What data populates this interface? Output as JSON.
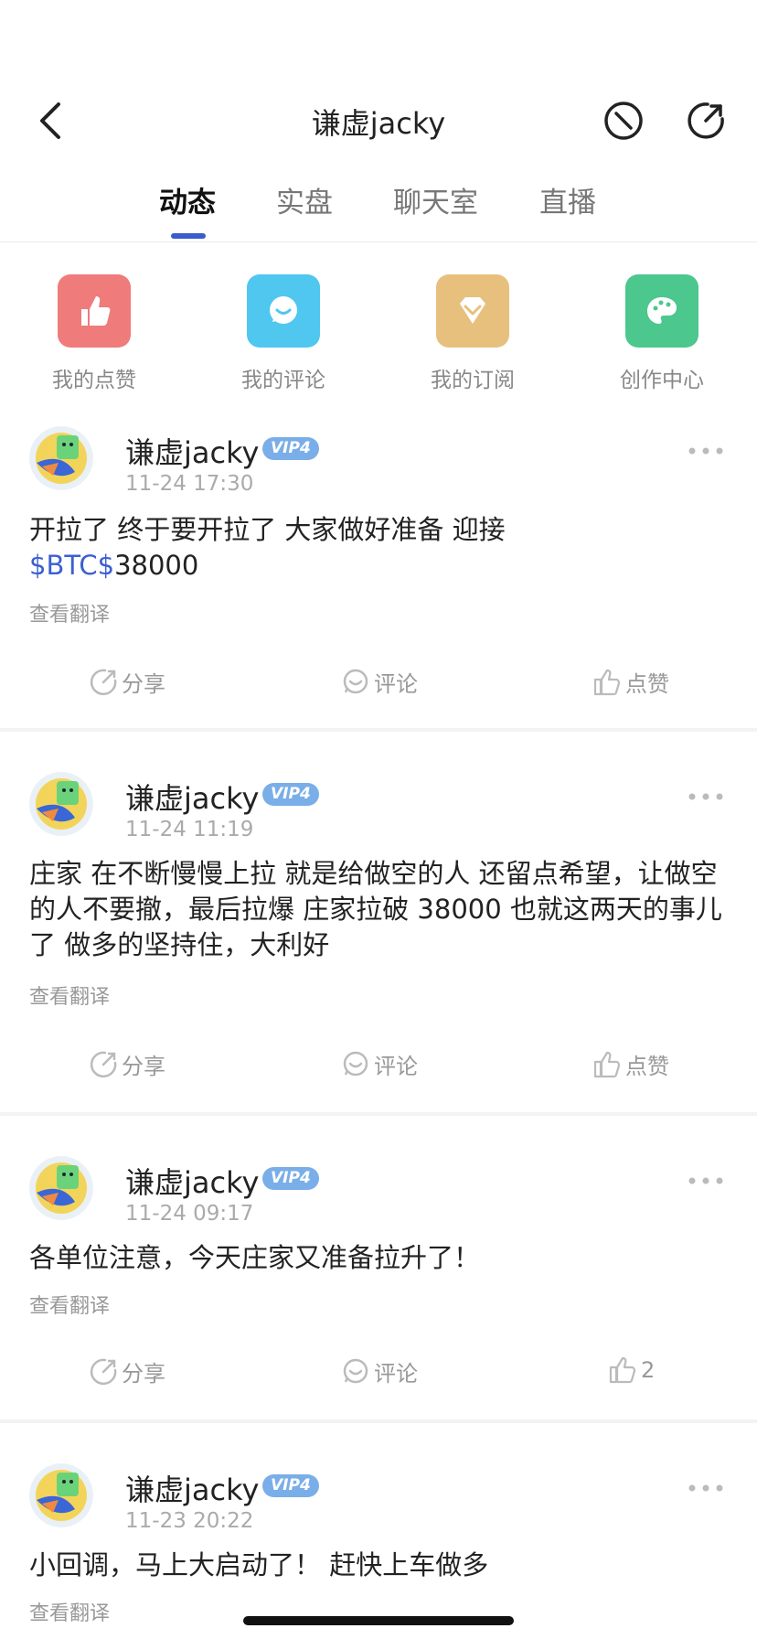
{
  "header": {
    "title": "谦虚jacky",
    "back_icon": "chevron-left-icon",
    "icons": [
      "block-icon",
      "share-icon"
    ]
  },
  "tabs": [
    {
      "label": "动态",
      "active": true
    },
    {
      "label": "实盘",
      "active": false
    },
    {
      "label": "聊天室",
      "active": false
    },
    {
      "label": "直播",
      "active": false
    }
  ],
  "quick_actions": [
    {
      "label": "我的点赞",
      "icon": "thumbs-up-icon",
      "color": "#ef7b7b"
    },
    {
      "label": "我的评论",
      "icon": "comment-icon",
      "color": "#4fc7ef"
    },
    {
      "label": "我的订阅",
      "icon": "diamond-icon",
      "color": "#e8c07e"
    },
    {
      "label": "创作中心",
      "icon": "palette-icon",
      "color": "#4cc78e"
    }
  ],
  "actions": {
    "share": "分享",
    "comment": "评论",
    "like": "点赞"
  },
  "posts": [
    {
      "user": "谦虚jacky",
      "vip": "VIP4",
      "time": "11-24 17:30",
      "text_a": "开拉了 终于要开拉了  大家做好准备 迎接",
      "cashtag": "$BTC$",
      "text_b": "38000",
      "translate": "查看翻译",
      "like_label": "点赞"
    },
    {
      "user": "谦虚jacky",
      "vip": "VIP4",
      "time": "11-24 11:19",
      "text_a": "庄家 在不断慢慢上拉 就是给做空的人 还留点希望，让做空的人不要撤，最后拉爆  庄家拉破 38000 也就这两天的事儿了  做多的坚持住，大利好",
      "translate": "查看翻译",
      "like_label": "点赞"
    },
    {
      "user": "谦虚jacky",
      "vip": "VIP4",
      "time": "11-24 09:17",
      "text_a": "各单位注意，今天庄家又准备拉升了！",
      "translate": "查看翻译",
      "like_label": "2"
    },
    {
      "user": "谦虚jacky",
      "vip": "VIP4",
      "time": "11-23 20:22",
      "text_a": "小回调，马上大启动了！  赶快上车做多",
      "translate": "查看翻译"
    }
  ]
}
